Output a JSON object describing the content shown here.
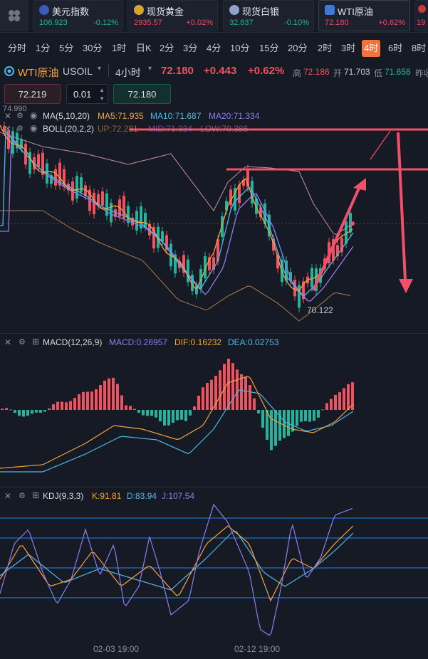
{
  "tickers": [
    {
      "name": "美元指数",
      "price": "106.923",
      "change": "-0.12%"
    },
    {
      "name": "现货黄金",
      "price": "2935.57",
      "change": "+0.02%"
    },
    {
      "name": "现货白银",
      "price": "32.837",
      "change": "-0.10%"
    },
    {
      "name": "WTI原油",
      "price": "72.180",
      "change": "+0.62%"
    },
    {
      "name": "",
      "price": "19"
    }
  ],
  "timeframes": [
    "分时",
    "1分",
    "5分",
    "30分",
    "1时",
    "日K",
    "2分",
    "3分",
    "4分",
    "10分",
    "15分",
    "20分",
    "2时",
    "3时",
    "4时",
    "6时",
    "8时"
  ],
  "active_timeframe": "4时",
  "symbol": {
    "name": "WTI原油",
    "code": "USOIL",
    "period": "4小时",
    "price": "72.180",
    "change": "+0.443",
    "change_pct": "+0.62%",
    "high_label": "高",
    "high": "72.186",
    "open_label": "开",
    "open": "71.703",
    "low_label": "低",
    "low": "71.658",
    "prev_label": "昨收"
  },
  "trade": {
    "sell_price": "72.219",
    "lot": "0.01",
    "buy_price": "72.180"
  },
  "main_chart": {
    "axis_top_price": "74.990",
    "low_marker": "70.122",
    "ma_label": "MA(5,10,20)",
    "ma5": "MA5:71.935",
    "ma10": "MA10:71.687",
    "ma20": "MA20:71.334",
    "boll_label": "BOLL(20,2,2)",
    "boll_up": "UP:72.281",
    "boll_mid": "MID:71.334",
    "boll_low": "LOW:70.386"
  },
  "macd": {
    "label": "MACD(12,26,9)",
    "macd": "MACD:0.26957",
    "dif": "DIF:0.16232",
    "dea": "DEA:0.02753"
  },
  "kdj": {
    "label": "KDJ(9,3,3)",
    "k": "K:91.81",
    "d": "D:83.94",
    "j": "J:107.54"
  },
  "x_axis": [
    "02-03 19:00",
    "02-12 19:00"
  ],
  "colors": {
    "up": "#f0535f",
    "down": "#24b39b",
    "ma5": "#f6a33b",
    "ma10": "#4fb8e8",
    "ma20": "#8d7cf0",
    "annotation": "#f2506a",
    "active_tab": "#f3723f"
  }
}
